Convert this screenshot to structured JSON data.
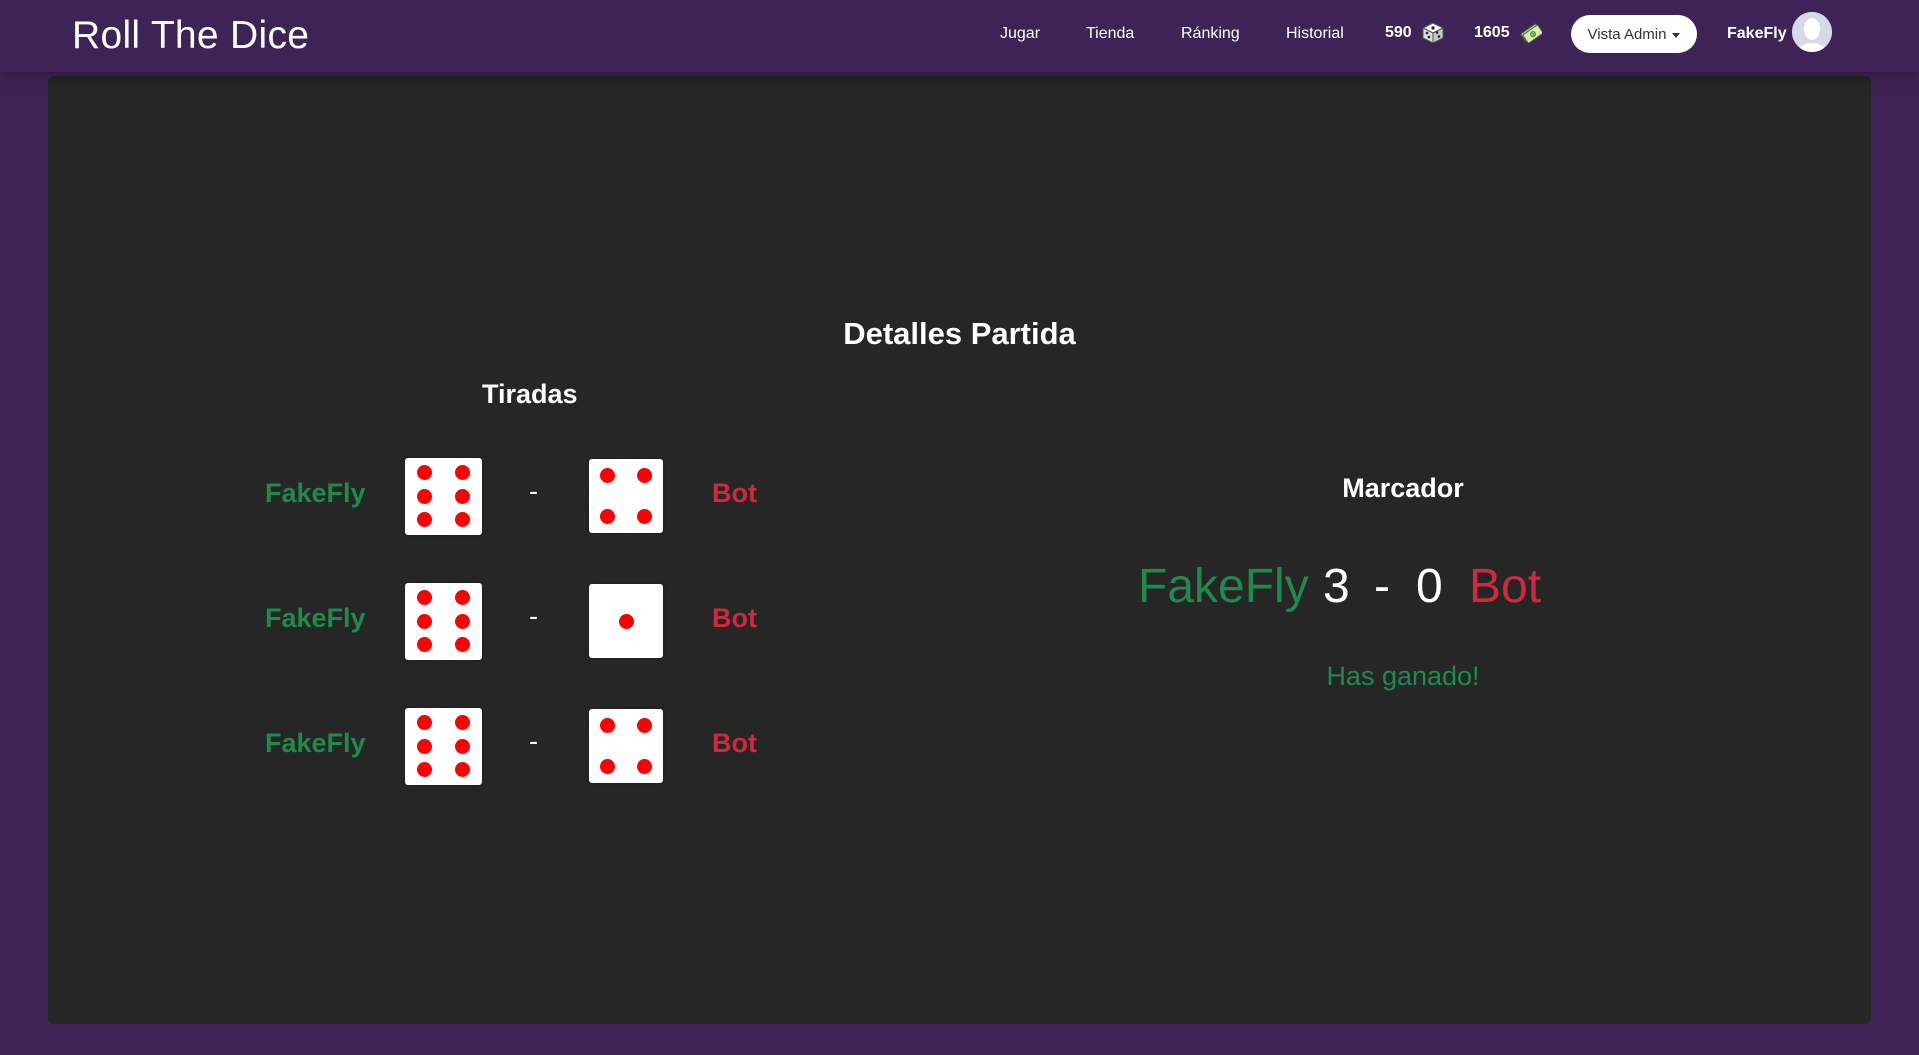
{
  "navbar": {
    "brand": "Roll The Dice",
    "links": [
      "Jugar",
      "Tienda",
      "Ránking",
      "Historial"
    ],
    "dice_count": "590",
    "dice_icon": "dice-icon",
    "money_count": "1605",
    "money_icon": "money-icon",
    "admin_dropdown": "Vista Admin",
    "username": "FakeFly",
    "avatar_icon": "user-avatar-icon"
  },
  "page": {
    "title": "Detalles Partida"
  },
  "rolls": {
    "title": "Tiradas",
    "separator": "-",
    "rows": [
      {
        "player": "FakeFly",
        "player_die": 6,
        "opponent": "Bot",
        "opponent_die": 4
      },
      {
        "player": "FakeFly",
        "player_die": 6,
        "opponent": "Bot",
        "opponent_die": 1
      },
      {
        "player": "FakeFly",
        "player_die": 6,
        "opponent": "Bot",
        "opponent_die": 4
      }
    ]
  },
  "scoreboard": {
    "title": "Marcador",
    "player": "FakeFly",
    "player_score": "3",
    "separator": "-",
    "opponent_score": "0",
    "opponent": "Bot",
    "result": "Has ganado!"
  },
  "colors": {
    "background": "#3e2456",
    "panel": "#262626",
    "winner": "#1e8a4c",
    "loser": "#d0283f",
    "pip": "#ff0000"
  }
}
